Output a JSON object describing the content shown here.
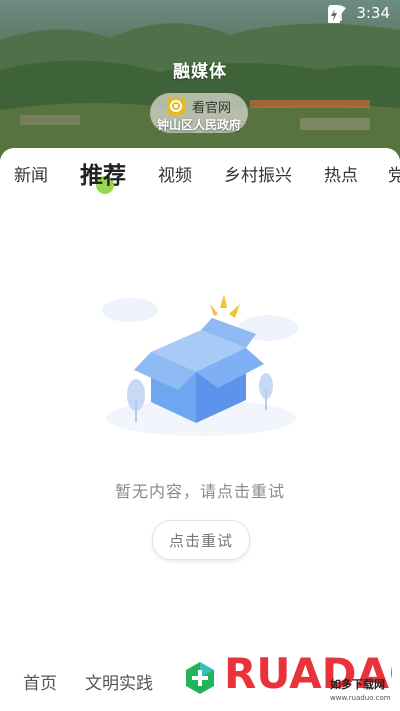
{
  "status": {
    "time": "3:34"
  },
  "header": {
    "title": "融媒体",
    "official_link": "看官网",
    "gov_label": "钟山区人民政府"
  },
  "tabs": [
    "新闻",
    "推荐",
    "视频",
    "乡村振兴",
    "热点",
    "党"
  ],
  "active_tab": "推荐",
  "empty_state": {
    "message": "暂无内容，请点击重试",
    "retry_label": "点击重试"
  },
  "bottom_nav": {
    "items": [
      "首页",
      "文明实践"
    ]
  },
  "watermark": {
    "text": "RUADAO",
    "sub": "如多下载网",
    "url": "www.ruaduo.com"
  },
  "colors": {
    "accent": "#8fd23a",
    "box_blue": "#5b9bef",
    "plus_green": "#22b35c"
  }
}
